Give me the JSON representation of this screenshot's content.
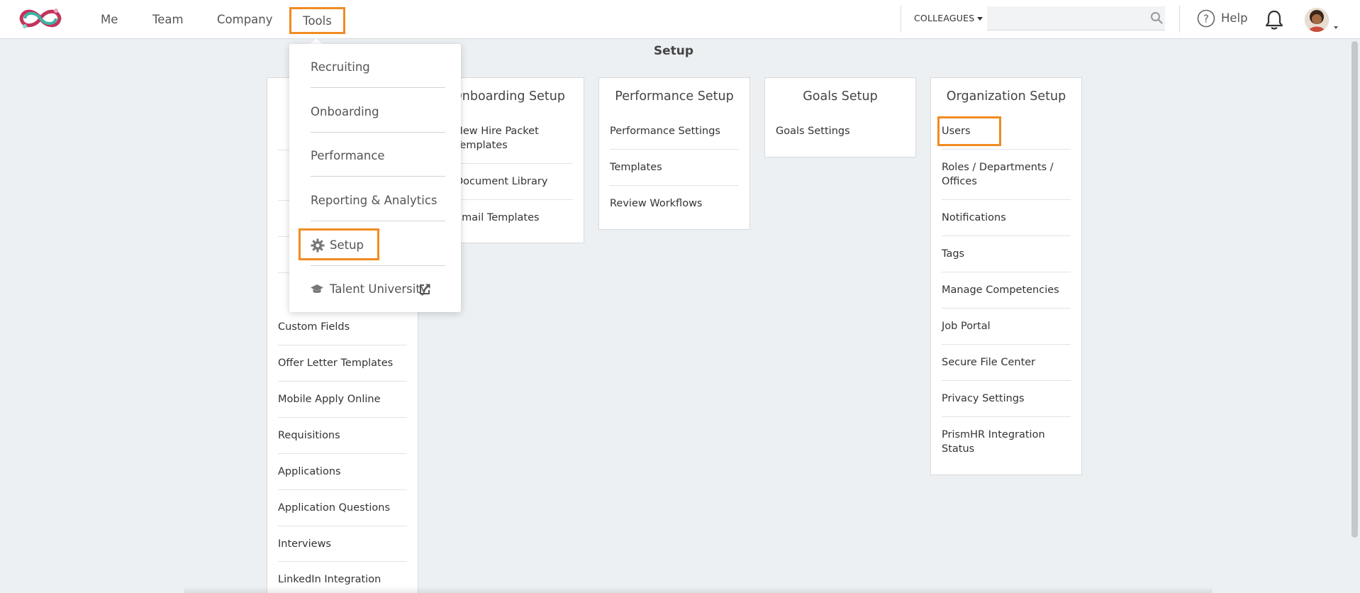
{
  "nav": {
    "me": "Me",
    "team": "Team",
    "company": "Company",
    "tools": "Tools",
    "colleagues": "COLLEAGUES",
    "help": "Help",
    "search_value": ""
  },
  "page": {
    "title": "Setup"
  },
  "dropdown": {
    "items": [
      {
        "label": "Recruiting"
      },
      {
        "label": "Onboarding"
      },
      {
        "label": "Performance"
      },
      {
        "label": "Reporting & Analytics"
      },
      {
        "label": "Setup"
      },
      {
        "label": "Talent University"
      }
    ]
  },
  "recruiting_setup": {
    "items": [
      "Custom Fields",
      "Offer Letter Templates",
      "Mobile Apply Online",
      "Requisitions",
      "Applications",
      "Application Questions",
      "Interviews",
      "LinkedIn Integration"
    ]
  },
  "onboarding_setup": {
    "title": "Onboarding Setup",
    "items": [
      "New Hire Packet Templates",
      "Document Library",
      "Email Templates"
    ]
  },
  "performance_setup": {
    "title": "Performance Setup",
    "items": [
      "Performance Settings",
      "Templates",
      "Review Workflows"
    ]
  },
  "goals_setup": {
    "title": "Goals Setup",
    "items": [
      "Goals Settings"
    ]
  },
  "organization_setup": {
    "title": "Organization Setup",
    "items": [
      "Users",
      "Roles / Departments / Offices",
      "Notifications",
      "Tags",
      "Manage Competencies",
      "Job Portal",
      "Secure File Center",
      "Privacy Settings",
      "PrismHR Integration Status"
    ]
  },
  "colors": {
    "accent_highlight": "#f28b22",
    "background": "#ecf0f3",
    "card": "#ffffff"
  },
  "icons": [
    "logo",
    "search-icon",
    "help-icon",
    "bell-icon",
    "gear-icon",
    "graduation-cap-icon",
    "external-link-icon"
  ]
}
